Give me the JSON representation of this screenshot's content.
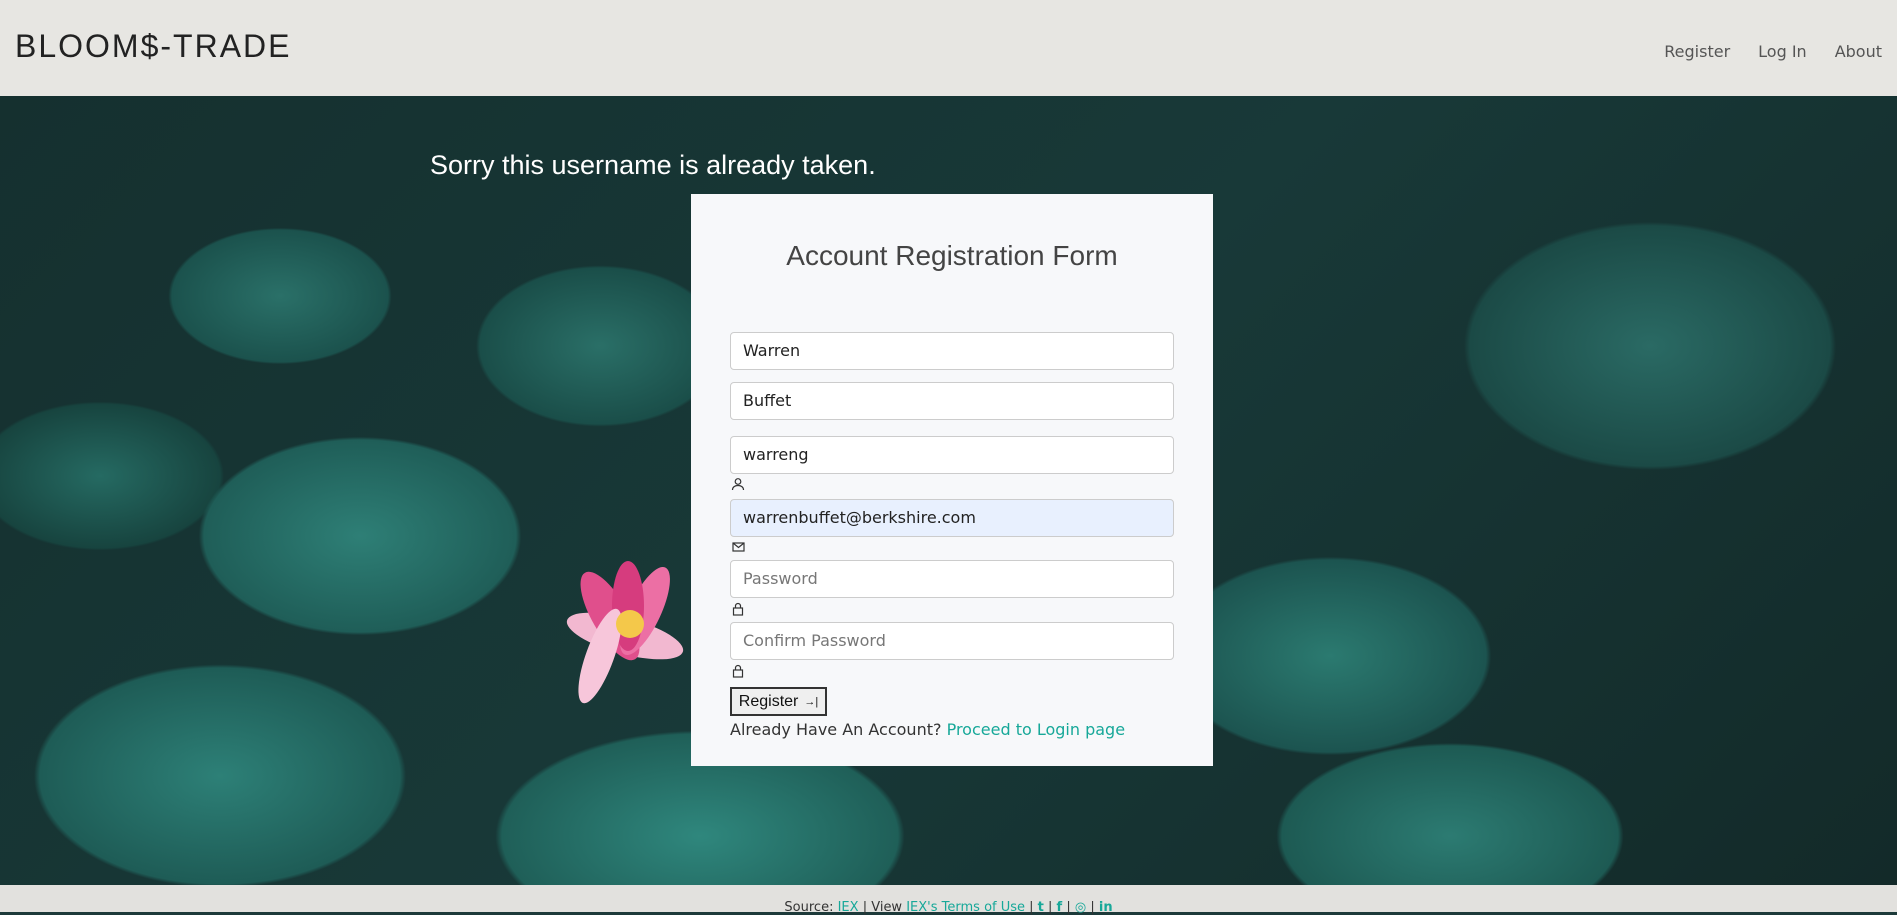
{
  "header": {
    "logo": "BLOOM$-TRADE",
    "nav": [
      {
        "label": "Register"
      },
      {
        "label": "Log In"
      },
      {
        "label": "About"
      }
    ]
  },
  "message": "Sorry this username is already taken.",
  "form": {
    "title": "Account Registration Form",
    "first_name": {
      "value": "Warren"
    },
    "last_name": {
      "value": "Buffet"
    },
    "username": {
      "value": "warreng",
      "icon": "person-icon"
    },
    "email": {
      "value": "warrenbuffet@berkshire.com",
      "icon": "envelope-icon"
    },
    "password": {
      "placeholder": "Password",
      "icon": "lock-icon"
    },
    "confirm_password": {
      "placeholder": "Confirm Password",
      "icon": "lock-icon"
    },
    "submit_label": "Register",
    "already_text": "Already Have An Account?",
    "login_link": "Proceed to Login page"
  },
  "footer": {
    "source_label": "Source:",
    "source_link": "IEX",
    "view_label": "View",
    "terms_link": "IEX's Terms of Use",
    "socials": [
      "twitter-icon",
      "facebook-icon",
      "instagram-icon",
      "linkedin-icon"
    ]
  },
  "colors": {
    "accent": "#17a899",
    "header_bg": "#e7e6e2"
  }
}
